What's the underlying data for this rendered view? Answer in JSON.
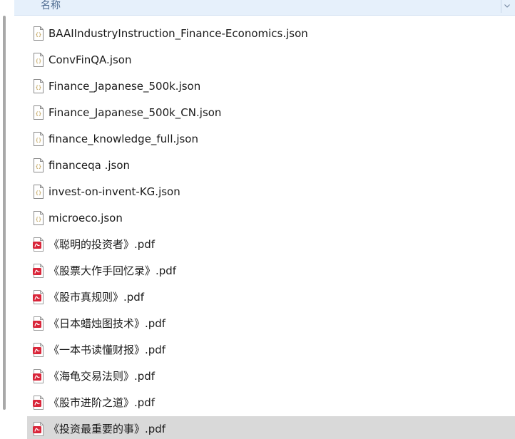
{
  "header": {
    "column_label": "名称",
    "chevron_icon": "chevron-down-icon"
  },
  "files": [
    {
      "name": "BAAIIndustryInstruction_Finance-Economics.json",
      "icon": "json-file-icon",
      "selected": false
    },
    {
      "name": "ConvFinQA.json",
      "icon": "json-file-icon",
      "selected": false
    },
    {
      "name": "Finance_Japanese_500k.json",
      "icon": "json-file-icon",
      "selected": false
    },
    {
      "name": "Finance_Japanese_500k_CN.json",
      "icon": "json-file-icon",
      "selected": false
    },
    {
      "name": "finance_knowledge_full.json",
      "icon": "json-file-icon",
      "selected": false
    },
    {
      "name": "financeqa .json",
      "icon": "json-file-icon",
      "selected": false
    },
    {
      "name": "invest-on-invent-KG.json",
      "icon": "json-file-icon",
      "selected": false
    },
    {
      "name": "microeco.json",
      "icon": "json-file-icon",
      "selected": false
    },
    {
      "name": "《聪明的投资者》.pdf",
      "icon": "pdf-file-icon",
      "selected": false
    },
    {
      "name": "《股票大作手回忆录》.pdf",
      "icon": "pdf-file-icon",
      "selected": false
    },
    {
      "name": "《股市真规则》.pdf",
      "icon": "pdf-file-icon",
      "selected": false
    },
    {
      "name": "《日本蜡烛图技术》.pdf",
      "icon": "pdf-file-icon",
      "selected": false
    },
    {
      "name": "《一本书读懂财报》.pdf",
      "icon": "pdf-file-icon",
      "selected": false
    },
    {
      "name": "《海龟交易法则》.pdf",
      "icon": "pdf-file-icon",
      "selected": false
    },
    {
      "name": "《股市进阶之道》.pdf",
      "icon": "pdf-file-icon",
      "selected": false
    },
    {
      "name": "《投资最重要的事》.pdf",
      "icon": "pdf-file-icon",
      "selected": true
    }
  ],
  "colors": {
    "header_bg": "#e6f0fb",
    "selected_bg": "#d9d9d9",
    "pdf_red": "#d9263a",
    "json_outline": "#8a8a8a"
  }
}
